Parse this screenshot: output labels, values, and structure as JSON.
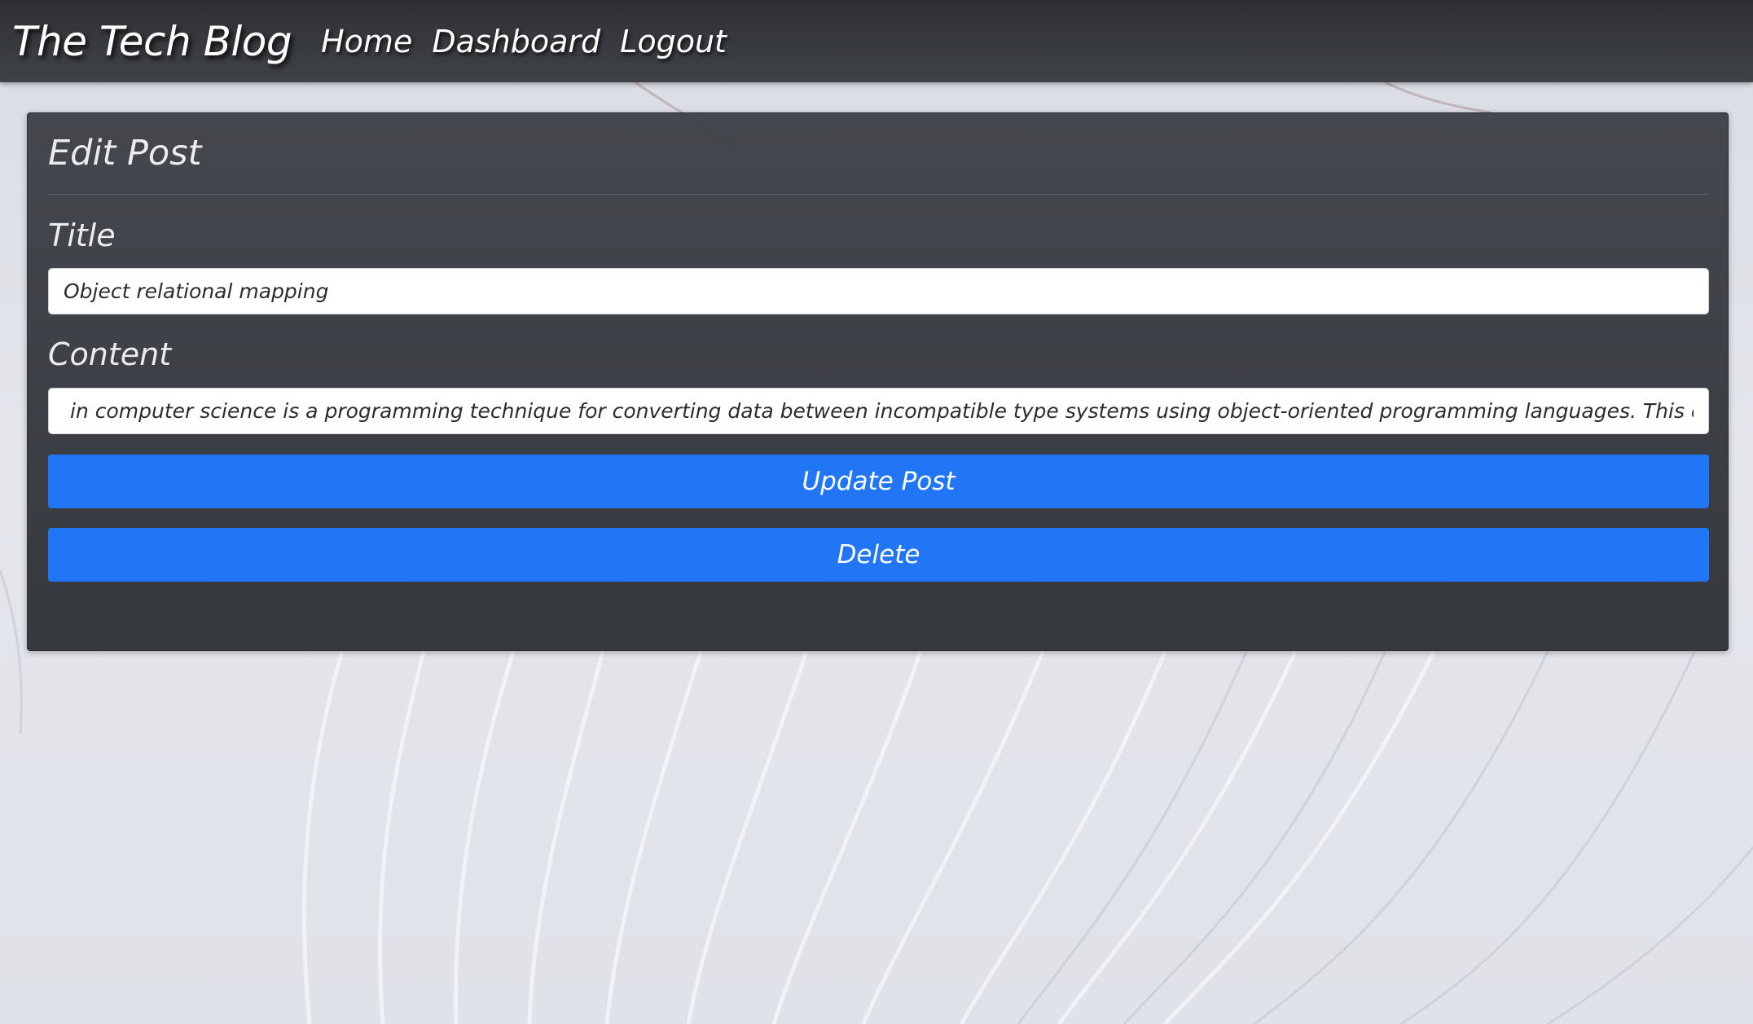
{
  "header": {
    "brand": "The Tech Blog",
    "nav": [
      "Home",
      "Dashboard",
      "Logout"
    ]
  },
  "form": {
    "heading": "Edit Post",
    "title_label": "Title",
    "title_value": "Object relational mapping",
    "content_label": "Content",
    "content_value": "in computer science is a programming technique for converting data between incompatible type systems using object-oriented programming languages. This creates,",
    "update_label": "Update Post",
    "delete_label": "Delete"
  },
  "colors": {
    "navbar": "#35373b",
    "card": "#3a3d42",
    "accent_button": "#2176f5",
    "background": "#dfe2e8"
  }
}
